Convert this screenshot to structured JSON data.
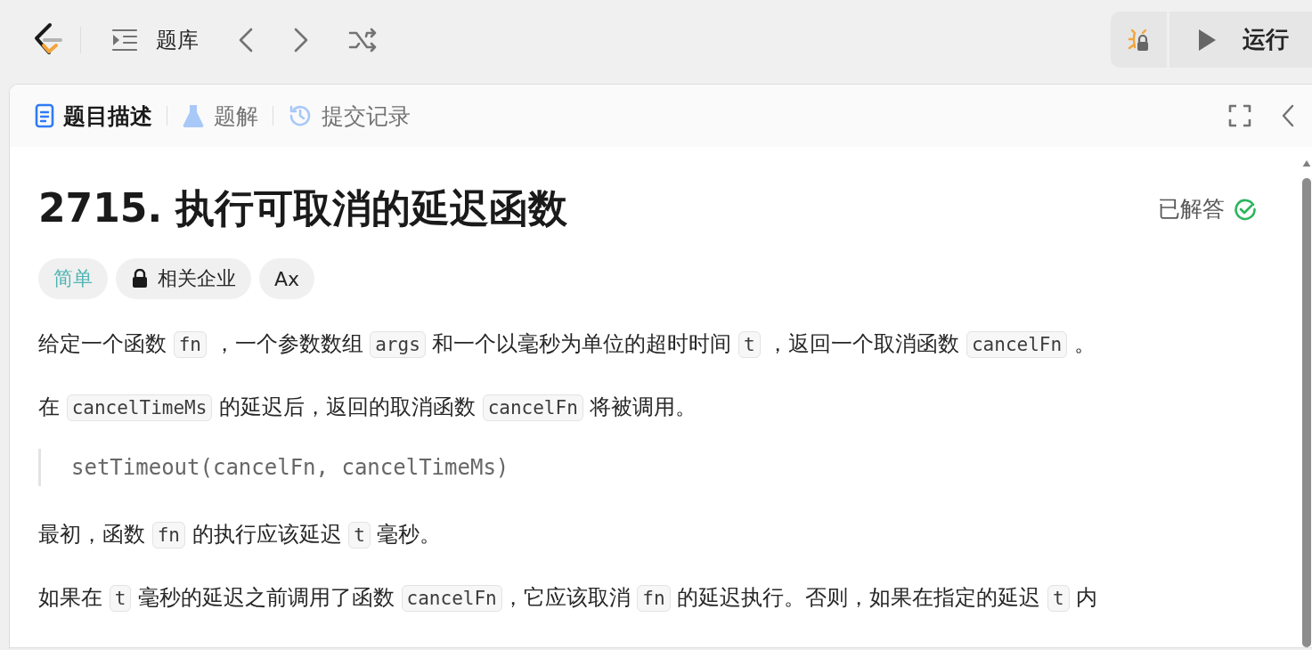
{
  "topbar": {
    "nav_label": "题库",
    "run_label": "运行"
  },
  "tabs": [
    {
      "label": "题目描述",
      "selected": true,
      "kind": "doc"
    },
    {
      "label": "题解",
      "selected": false,
      "kind": "flask"
    },
    {
      "label": "提交记录",
      "selected": false,
      "kind": "history"
    }
  ],
  "problem": {
    "title": "2715. 执行可取消的延迟函数",
    "status": "已解答",
    "solved": true,
    "tags": [
      {
        "label": "简单",
        "kind": "difficulty"
      },
      {
        "label": "相关企业",
        "kind": "locked"
      },
      {
        "label": "Ax",
        "kind": "translate"
      }
    ]
  },
  "content": [
    {
      "kind": "paragraph",
      "parts": [
        {
          "kind": "text",
          "text": "给定一个函数 "
        },
        {
          "kind": "code",
          "text": "fn"
        },
        {
          "kind": "text",
          "text": " ，一个参数数组 "
        },
        {
          "kind": "code",
          "text": "args"
        },
        {
          "kind": "text",
          "text": " 和一个以毫秒为单位的超时时间 "
        },
        {
          "kind": "code",
          "text": "t"
        },
        {
          "kind": "text",
          "text": " ，返回一个取消函数 "
        },
        {
          "kind": "code",
          "text": "cancelFn"
        },
        {
          "kind": "text",
          "text": " 。"
        }
      ]
    },
    {
      "kind": "paragraph",
      "parts": [
        {
          "kind": "text",
          "text": "在 "
        },
        {
          "kind": "code",
          "text": "cancelTimeMs"
        },
        {
          "kind": "text",
          "text": " 的延迟后，返回的取消函数 "
        },
        {
          "kind": "code",
          "text": "cancelFn"
        },
        {
          "kind": "text",
          "text": " 将被调用。"
        }
      ]
    },
    {
      "kind": "quote",
      "text": "setTimeout(cancelFn, cancelTimeMs)"
    },
    {
      "kind": "paragraph",
      "parts": [
        {
          "kind": "text",
          "text": "最初，函数 "
        },
        {
          "kind": "code",
          "text": "fn"
        },
        {
          "kind": "text",
          "text": " 的执行应该延迟 "
        },
        {
          "kind": "code",
          "text": "t"
        },
        {
          "kind": "text",
          "text": " 毫秒。"
        }
      ]
    },
    {
      "kind": "paragraph",
      "parts": [
        {
          "kind": "text",
          "text": "如果在 "
        },
        {
          "kind": "code",
          "text": "t"
        },
        {
          "kind": "text",
          "text": " 毫秒的延迟之前调用了函数 "
        },
        {
          "kind": "code",
          "text": "cancelFn"
        },
        {
          "kind": "text",
          "text": "，它应该取消 "
        },
        {
          "kind": "code",
          "text": "fn"
        },
        {
          "kind": "text",
          "text": " 的延迟执行。否则，如果在指定的延迟 "
        },
        {
          "kind": "code",
          "text": "t"
        },
        {
          "kind": "text",
          "text": " 内"
        }
      ]
    }
  ]
}
